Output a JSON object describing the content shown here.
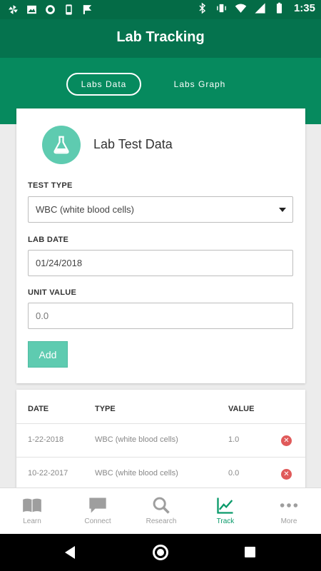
{
  "status_bar": {
    "time": "1:35",
    "left_icons": [
      "pinwheel-icon",
      "image-icon",
      "circle-record-icon",
      "phone-notification-icon",
      "check-flag-icon"
    ],
    "right_icons": [
      "bluetooth-icon",
      "vibrate-icon",
      "wifi-icon",
      "signal-icon",
      "battery-icon"
    ]
  },
  "app_bar": {
    "title": "Lab Tracking"
  },
  "tabs": [
    {
      "label": "Labs Data",
      "active": true
    },
    {
      "label": "Labs Graph",
      "active": false
    }
  ],
  "form": {
    "icon": "flask-icon",
    "title": "Lab Test Data",
    "test_type": {
      "label": "TEST TYPE",
      "value": "WBC (white blood cells)"
    },
    "lab_date": {
      "label": "LAB DATE",
      "value": "01/24/2018"
    },
    "unit_value": {
      "label": "UNIT VALUE",
      "placeholder": "0.0"
    },
    "add_label": "Add"
  },
  "table": {
    "headers": {
      "date": "DATE",
      "type": "TYPE",
      "value": "VALUE"
    },
    "rows": [
      {
        "date": "1-22-2018",
        "type": "WBC (white blood cells)",
        "value": "1.0"
      },
      {
        "date": "10-22-2017",
        "type": "WBC (white blood cells)",
        "value": "0.0"
      }
    ]
  },
  "bottom_nav": [
    {
      "label": "Learn",
      "icon": "book-icon",
      "active": false
    },
    {
      "label": "Connect",
      "icon": "chat-bubble-icon",
      "active": false
    },
    {
      "label": "Research",
      "icon": "search-icon",
      "active": false
    },
    {
      "label": "Track",
      "icon": "line-chart-icon",
      "active": true
    },
    {
      "label": "More",
      "icon": "more-dots-icon",
      "active": false
    }
  ],
  "colors": {
    "status_bar": "#046b46",
    "app_bar": "#05734e",
    "tabs_band": "#068a5e",
    "accent": "#5ecbb0",
    "active_nav": "#0a9a6a",
    "delete": "#e05a5a"
  }
}
